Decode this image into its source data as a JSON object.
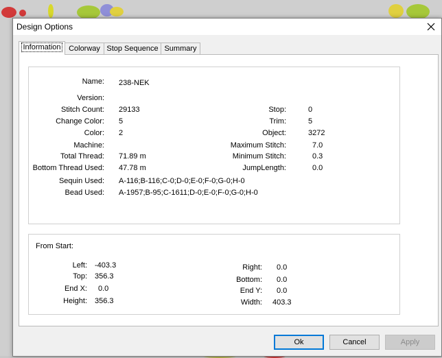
{
  "window": {
    "title": "Design Options"
  },
  "tabs": [
    "Information",
    "Colorway",
    "Stop Sequence",
    "Summary"
  ],
  "info": {
    "name_label": "Name:",
    "name": "238-NEK",
    "version_label": "Version:",
    "version": "",
    "stitch_count_label": "Stitch Count:",
    "stitch_count": "29133",
    "change_color_label": "Change Color:",
    "change_color": "5",
    "color_label": "Color:",
    "color": "2",
    "machine_label": "Machine:",
    "machine": "",
    "total_thread_label": "Total Thread:",
    "total_thread": "71.89 m",
    "bottom_thread_label": "Bottom Thread Used:",
    "bottom_thread": "47.78 m",
    "sequin_label": "Sequin Used:",
    "sequin": "A-116;B-116;C-0;D-0;E-0;F-0;G-0;H-0",
    "bead_label": "Bead Used:",
    "bead": "A-1957;B-95;C-1611;D-0;E-0;F-0;G-0;H-0",
    "stop_label": "Stop:",
    "stop": "0",
    "trim_label": "Trim:",
    "trim": "5",
    "object_label": "Object:",
    "object": "3272",
    "max_stitch_label": "Maximum Stitch:",
    "max_stitch": "7.0",
    "min_stitch_label": "Minimum Stitch:",
    "min_stitch": "0.3",
    "jump_length_label": "JumpLength:",
    "jump_length": "0.0"
  },
  "from_start": {
    "heading": "From Start:",
    "left_label": "Left:",
    "left": "-403.3",
    "top_label": "Top:",
    "top": "356.3",
    "endx_label": "End X:",
    "endx": "0.0",
    "height_label": "Height:",
    "height": "356.3",
    "right_label": "Right:",
    "right": "0.0",
    "bottom_label": "Bottom:",
    "bottom": "0.0",
    "endy_label": "End Y:",
    "endy": "0.0",
    "width_label": "Width:",
    "width": "403.3"
  },
  "buttons": {
    "ok": "Ok",
    "cancel": "Cancel",
    "apply": "Apply"
  },
  "colors": {
    "accent": "#0078d7"
  }
}
